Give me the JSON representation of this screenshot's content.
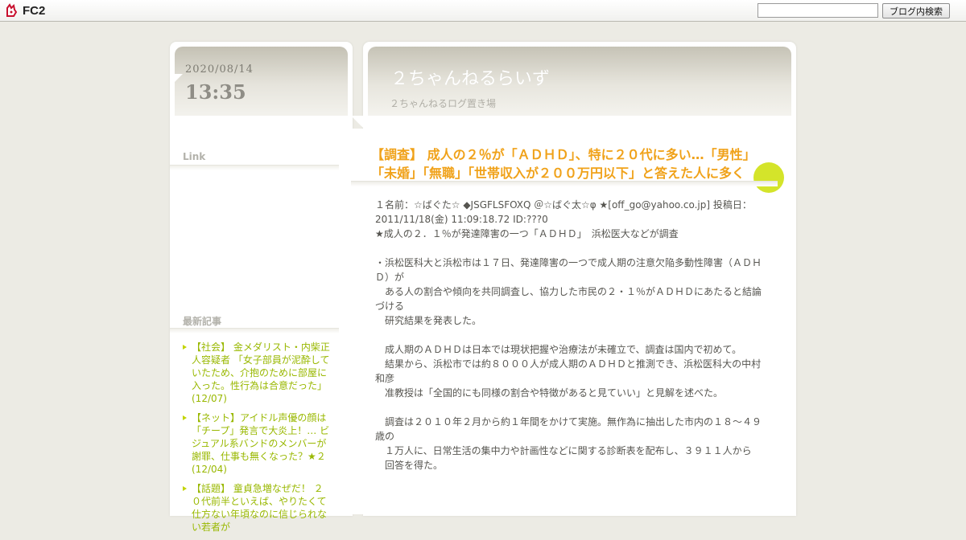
{
  "topbar": {
    "logo_text": "FC2",
    "search_placeholder": "",
    "search_button": "ブログ内検索"
  },
  "sidebar": {
    "date": "2020/08/14",
    "time": "13:35",
    "link_heading": "Link",
    "recent_heading": "最新記事",
    "recent_items": [
      "【社会】 金メダリスト・内柴正人容疑者 「女子部員が泥酔していたため、介抱のために部屋に入った。性行為は合意だった」 (12/07)",
      "【ネット】アイドル声優の顔は「チープ」発言で大炎上！… ビジュアル系バンドのメンバーが謝罪、仕事も無くなった？★２ (12/04)",
      "【話題】 童貞急増なぜだ！ ２０代前半といえば、やりたくて仕方ない年頃なのに信じられない若者が"
    ]
  },
  "header": {
    "title": "２ちゃんねるらいず",
    "description": "２ちゃんねるログ置き場"
  },
  "entry": {
    "title_line1": "【調査】 成人の２％が「ＡＤＨＤ」、特に２０代に多い…「男性」",
    "title_line2": "「未婚」「無職」「世帯収入が２００万円以下」と答えた人に多く",
    "body": "１名前：☆ばぐた☆ ◆JSGFLSFOXQ ＠☆ばぐ太☆φ ★[off_go@yahoo.co.jp] 投稿日：2011/11/18(金) 11:09:18.72 ID:???0\n★成人の２．１％が発達障害の一つ「ＡＤＨＤ」　浜松医大などが調査\n\n・浜松医科大と浜松市は１７日、発達障害の一つで成人期の注意欠陥多動性障害（ＡＤＨＤ）が\n　ある人の割合や傾向を共同調査し、協力した市民の２・１％がＡＤＨＤにあたると結論づける\n　研究結果を発表した。\n\n　成人期のＡＤＨＤは日本では現状把握や治療法が未確立で、調査は国内で初めて。\n　結果から、浜松市では約８０００人が成人期のＡＤＨＤと推測でき、浜松医科大の中村和彦\n　准教授は「全国的にも同様の割合や特徴があると見ていい」と見解を述べた。\n\n　調査は２０１０年２月から約１年間をかけて実施。無作為に抽出した市内の１８～４９歳の\n　１万人に、日常生活の集中力や計画性などに関する診断表を配布し、３９１１人から\n　回答を得た。"
  }
}
